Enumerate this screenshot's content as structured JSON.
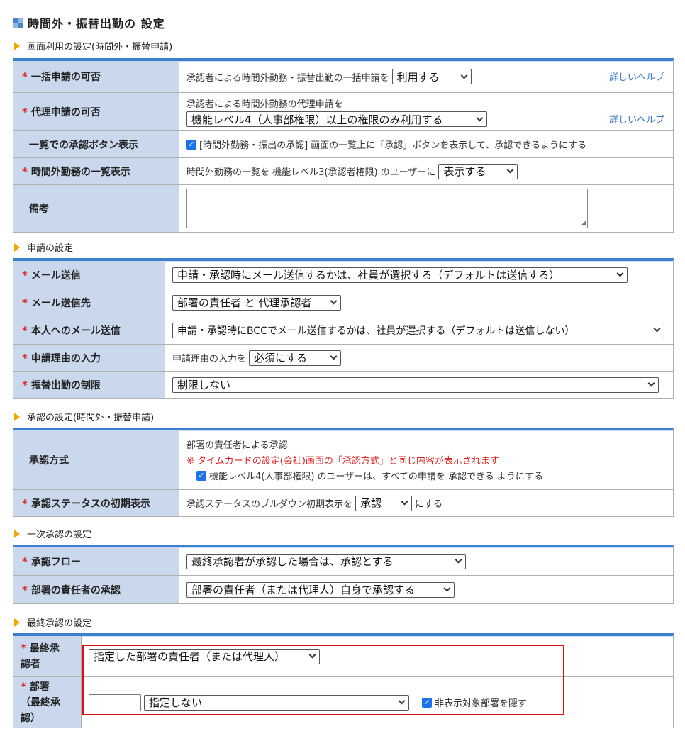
{
  "page_title": "時間外・振替出勤の 設定",
  "sections": {
    "s1": "画面利用の設定(時間外・振替申請)",
    "s2": "申請の設定",
    "s3": "承認の設定(時間外・振替申請)",
    "s4": "一次承認の設定",
    "s5": "最終承認の設定"
  },
  "required_mark": "*",
  "help_link": "詳しいヘルプ",
  "screen_usage": {
    "bulk": {
      "label": "一括申請の可否",
      "text": "承認者による時間外勤務・振替出勤の一括申請を",
      "select": "利用する"
    },
    "proxy": {
      "label": "代理申請の可否",
      "text": "承認者による時間外勤務の代理申請を",
      "select": "機能レベル4（人事部権限）以上の権限のみ利用する"
    },
    "list_button": {
      "label": "一覧での承認ボタン表示",
      "text": "[時間外勤務・振出の承認] 画面の一覧上に「承認」ボタンを表示して、承認できるようにする",
      "checked": true
    },
    "overtime_list": {
      "label": "時間外勤務の一覧表示",
      "text": "時間外勤務の一覧を 機能レベル3(承認者権限) のユーザーに",
      "select": "表示する"
    },
    "notes": {
      "label": "備考"
    }
  },
  "application": {
    "mail": {
      "label": "メール送信",
      "select": "申請・承認時にメール送信するかは、社員が選択する（デフォルトは送信する）"
    },
    "mail_to": {
      "label": "メール送信先",
      "select": "部署の責任者 と 代理承認者"
    },
    "self_mail": {
      "label": "本人へのメール送信",
      "select": "申請・承認時にBCCでメール送信するかは、社員が選択する（デフォルトは送信しない）"
    },
    "reason": {
      "label": "申請理由の入力",
      "text": "申請理由の入力を",
      "select": "必須にする"
    },
    "holiday_limit": {
      "label": "振替出勤の制限",
      "select": "制限しない"
    }
  },
  "approval": {
    "method": {
      "label": "承認方式",
      "line1": "部署の責任者による承認",
      "note": "※ タイムカードの設定(会社)画面の「承認方式」と同じ内容が表示されます",
      "checkbox": "機能レベル4(人事部権限) のユーザーは、すべての申請を 承認できる ようにする",
      "checked": true
    },
    "status_default": {
      "label": "承認ステータスの初期表示",
      "text_before": "承認ステータスのプルダウン初期表示を",
      "select": "承認",
      "text_after": "にする"
    }
  },
  "first_approval": {
    "flow": {
      "label": "承認フロー",
      "select": "最終承認者が承認した場合は、承認とする"
    },
    "manager": {
      "label": "部署の責任者の承認",
      "select": "部署の責任者（または代理人）自身で承認する"
    }
  },
  "final_approval": {
    "approver": {
      "label_line1": "最終承",
      "label_line2": "認者",
      "select": "指定した部署の責任者（または代理人）"
    },
    "dept": {
      "label_line1": "部署",
      "label_line2": "（最終承",
      "label_line3": "認）",
      "input": "",
      "select": "指定しない",
      "checkbox": "非表示対象部署を隠す",
      "checked": true
    }
  }
}
